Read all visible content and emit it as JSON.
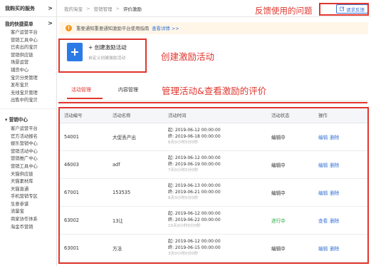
{
  "sidebar": {
    "header": "我购买的服务",
    "header_arrow": ">",
    "section1": "我的快捷菜单",
    "section1_arrow": ">",
    "items1": [
      "客户运营平台",
      "营销工具中心",
      "已卖出的宝贝",
      "营销供应链",
      "场景运营",
      "铺货中心",
      "宝贝分类管理",
      "发布宝贝",
      "无线宝贝管理",
      "出售中的宝贝"
    ],
    "section2": "▾ 营销中心",
    "items2": [
      "客户运营平台",
      "官方活动报名",
      "娱乐营销中心",
      "营销活动中心",
      "营销推广中心",
      "营销工具中心",
      "天猫供应链",
      "天猫素材库",
      "天猫直通",
      "手机营销专区",
      "生意参谋",
      "流量宝",
      "商家协作体系",
      "淘金币营销"
    ]
  },
  "breadcrumb": {
    "items": [
      "我的淘宝",
      "营销管理",
      "评价激励"
    ],
    "sep": ">"
  },
  "feedback_button": {
    "label": "请求反馈"
  },
  "notice": {
    "icon": "!",
    "text": "重要通知重要通知激励平台使用指南",
    "link": "查看详情 >>"
  },
  "create": {
    "title": "+ 创建激励活动",
    "subtitle": "自定义创建激励活动"
  },
  "annotations": {
    "feedback": "反馈使用的问题",
    "create": "创建激励活动",
    "manage": "管理活动&查看激励的评价"
  },
  "tabs": [
    "活动管理",
    "内容管理"
  ],
  "table": {
    "headers": [
      "活动编号",
      "活动名称",
      "活动时间",
      "活动状态",
      "操作"
    ],
    "rows": [
      {
        "id": "54001",
        "name": "大促丢产出",
        "start": "起: 2019-06-12 00:00:00",
        "end": "终: 2019-06-18 00:00:00",
        "dur": "6天0小时0分0秒",
        "status": "编辑中",
        "ops": [
          "编辑",
          "删除"
        ]
      },
      {
        "id": "46003",
        "name": "adf",
        "start": "起: 2019-06-12 00:00:00",
        "end": "终: 2019-06-19 00:00:00",
        "dur": "7天0小时0分0秒",
        "status": "编辑中",
        "ops": [
          "编辑",
          "删除"
        ]
      },
      {
        "id": "67001",
        "name": "153535",
        "start": "起: 2019-06-13 00:00:00",
        "end": "终: 2019-06-21 00:00:00",
        "dur": "8天0小时0分0秒",
        "status": "编辑中",
        "ops": [
          "编辑",
          "删除"
        ]
      },
      {
        "id": "63002",
        "name": "13让",
        "start": "起: 2019-06-12 00:00:00",
        "end": "终: 2019-06-22 00:00:00",
        "dur": "10天0小时0分0秒",
        "status": "进行中",
        "ops": [
          "查看",
          "删除"
        ]
      },
      {
        "id": "63001",
        "name": "方法",
        "start": "起: 2019-06-12 00:00:00",
        "end": "终: 2019-06-15 00:00:00",
        "dur": "3天0小时0分0秒",
        "status": "编辑中",
        "ops": [
          "编辑",
          "删除"
        ]
      }
    ]
  },
  "colors": {
    "accent_red": "#e0362e",
    "link_blue": "#3a74d6",
    "active_green": "#1fa936",
    "create_icon_blue": "#2b7be6"
  }
}
